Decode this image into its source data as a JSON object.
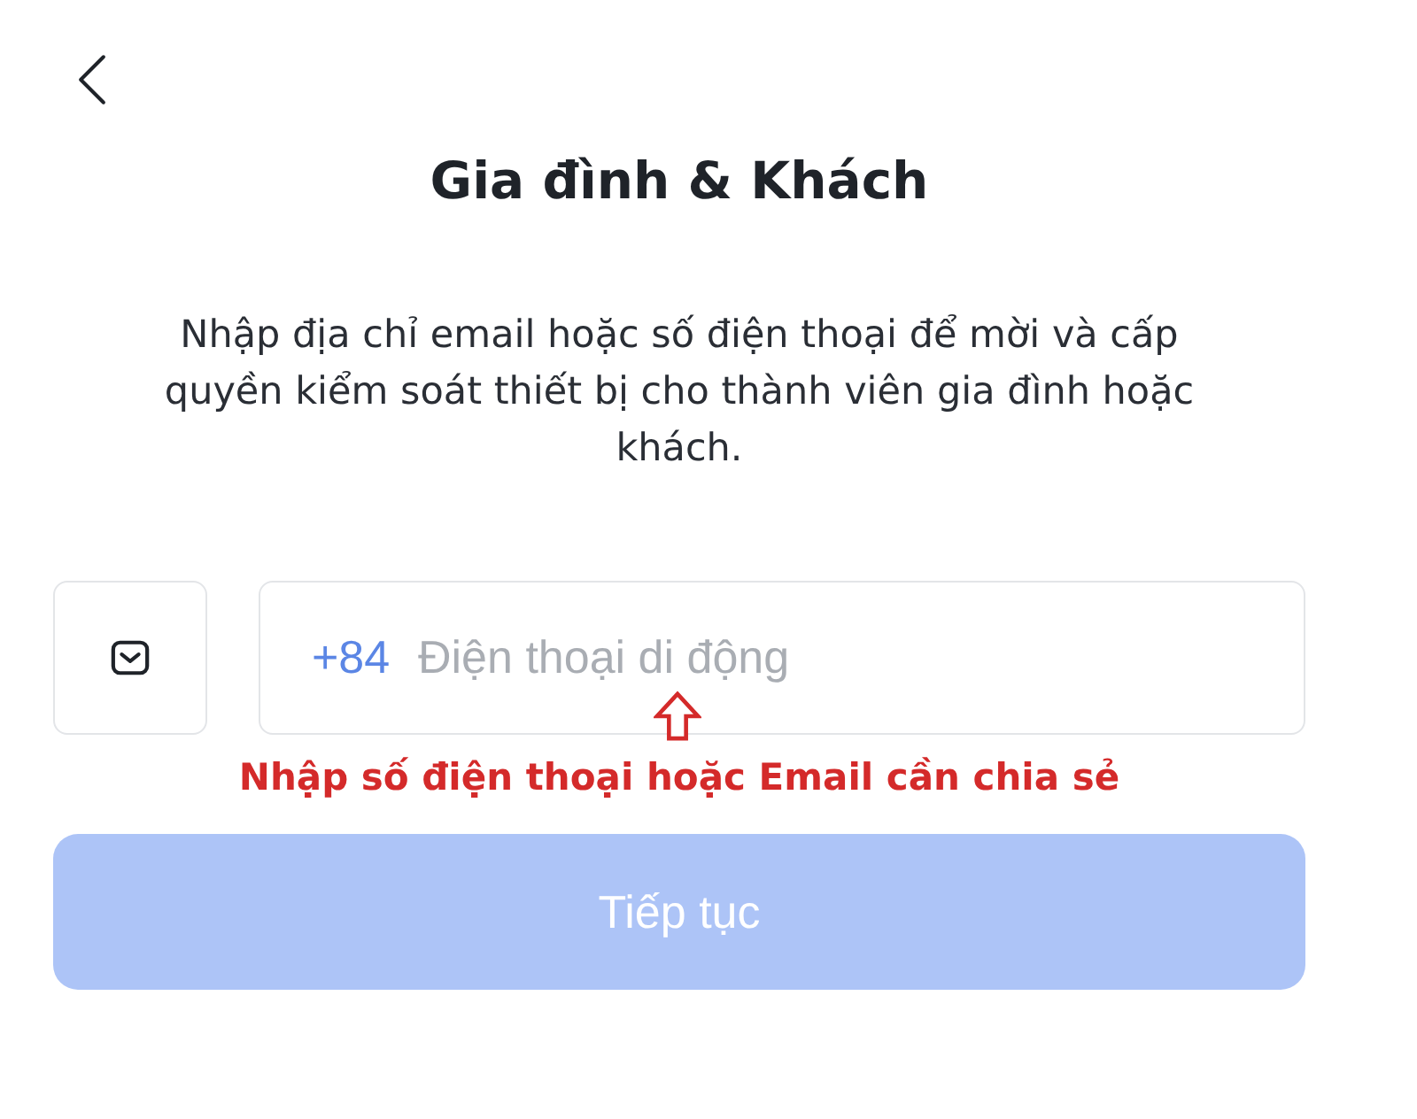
{
  "header": {
    "title": "Gia đình & Khách"
  },
  "description": "Nhập địa chỉ email hoặc số điện thoại để mời và cấp quyền kiểm soát thiết bị cho thành viên gia đình hoặc khách.",
  "phone_field": {
    "prefix": "+84",
    "placeholder": "Điện thoại di động"
  },
  "annotation": {
    "text": "Nhập số điện thoại hoặc Email cần chia sẻ"
  },
  "continue_button": {
    "label": "Tiếp tục",
    "disabled": true
  }
}
